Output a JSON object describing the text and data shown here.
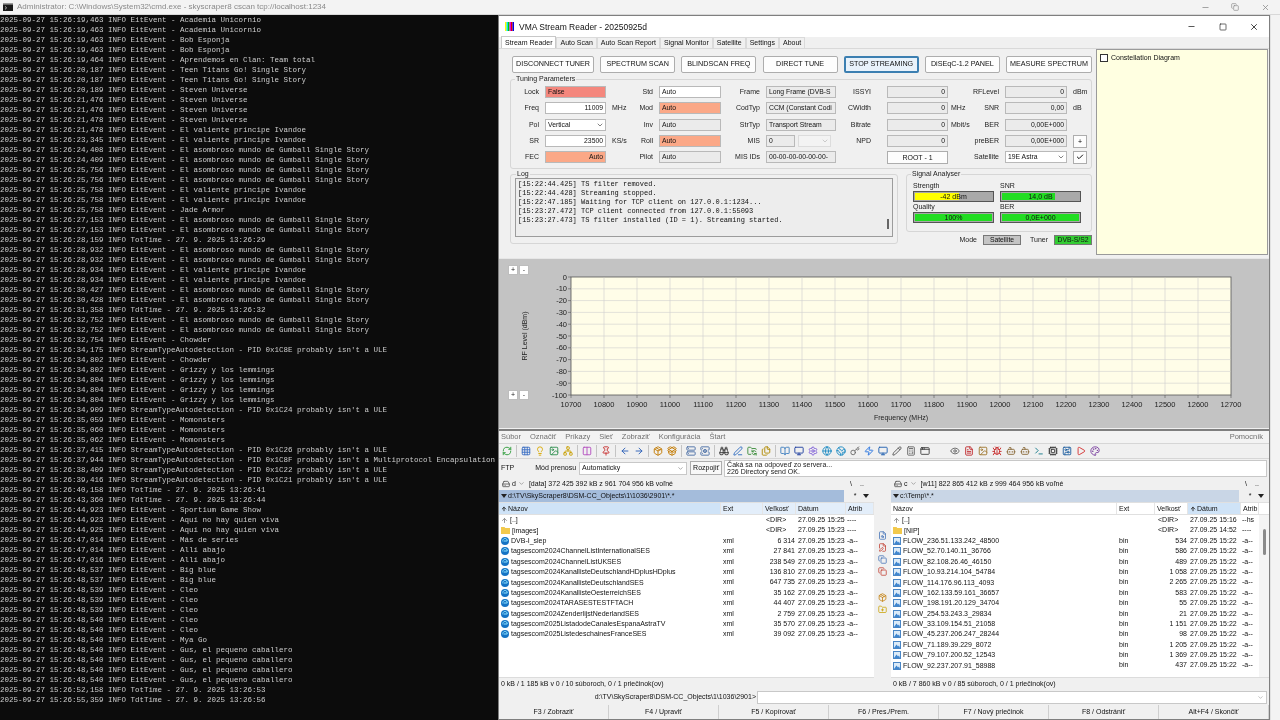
{
  "console": {
    "title": "Administrator: C:\\Windows\\System32\\cmd.exe - skyscraper8 cscan tcp://localhost:1234",
    "lines": [
      "2025-09-27 15:26:19,463 INFO EitEvent - Academia Unicornio",
      "2025-09-27 15:26:19,463 INFO EitEvent - Academia Unicornio",
      "2025-09-27 15:26:19,463 INFO EitEvent - Bob Esponja",
      "2025-09-27 15:26:19,463 INFO EitEvent - Bob Esponja",
      "2025-09-27 15:26:19,464 INFO EitEvent - Aprendemos en Clan: Team total",
      "2025-09-27 15:26:20,187 INFO EitEvent - Teen Titans Go! Single Story",
      "2025-09-27 15:26:20,187 INFO EitEvent - Teen Titans Go! Single Story",
      "2025-09-27 15:26:20,189 INFO EitEvent - Steven Universe",
      "2025-09-27 15:26:21,476 INFO EitEvent - Steven Universe",
      "2025-09-27 15:26:21,476 INFO EitEvent - Steven Universe",
      "2025-09-27 15:26:21,478 INFO EitEvent - Steven Universe",
      "2025-09-27 15:26:21,478 INFO EitEvent - El valiente príncipe Ivandoe",
      "2025-09-27 15:26:23,345 INFO EitEvent - El valiente príncipe Ivandoe",
      "2025-09-27 15:26:24,408 INFO EitEvent - El asombroso mundo de Gumball Single Story",
      "2025-09-27 15:26:24,409 INFO EitEvent - El asombroso mundo de Gumball Single Story",
      "2025-09-27 15:26:25,756 INFO EitEvent - El asombroso mundo de Gumball Single Story",
      "2025-09-27 15:26:25,756 INFO EitEvent - El asombroso mundo de Gumball Single Story",
      "2025-09-27 15:26:25,758 INFO EitEvent - El valiente príncipe Ivandoe",
      "2025-09-27 15:26:25,758 INFO EitEvent - El valiente príncipe Ivandoe",
      "2025-09-27 15:26:25,758 INFO EitEvent - Jade Armor",
      "2025-09-27 15:26:27,153 INFO EitEvent - El asombroso mundo de Gumball Single Story",
      "2025-09-27 15:26:27,153 INFO EitEvent - El asombroso mundo de Gumball Single Story",
      "2025-09-27 15:26:28,159 INFO TotTime - 27. 9. 2025 13:26:29",
      "2025-09-27 15:26:28,932 INFO EitEvent - El asombroso mundo de Gumball Single Story",
      "2025-09-27 15:26:28,932 INFO EitEvent - El asombroso mundo de Gumball Single Story",
      "2025-09-27 15:26:28,934 INFO EitEvent - El valiente príncipe Ivandoe",
      "2025-09-27 15:26:28,934 INFO EitEvent - El valiente príncipe Ivandoe",
      "2025-09-27 15:26:30,427 INFO EitEvent - El asombroso mundo de Gumball Single Story",
      "2025-09-27 15:26:30,428 INFO EitEvent - El asombroso mundo de Gumball Single Story",
      "2025-09-27 15:26:31,358 INFO TdtTime - 27. 9. 2025 13:26:32",
      "2025-09-27 15:26:32,752 INFO EitEvent - El asombroso mundo de Gumball Single Story",
      "2025-09-27 15:26:32,752 INFO EitEvent - El asombroso mundo de Gumball Single Story",
      "2025-09-27 15:26:32,754 INFO EitEvent - Chowder",
      "2025-09-27 15:26:34,175 INFO StreamTypeAutodetection - PID 0x1C8E probably isn't a ULE",
      "2025-09-27 15:26:34,802 INFO EitEvent - Chowder",
      "2025-09-27 15:26:34,802 INFO EitEvent - Grizzy y los lemmings",
      "2025-09-27 15:26:34,804 INFO EitEvent - Grizzy y los lemmings",
      "2025-09-27 15:26:34,804 INFO EitEvent - Grizzy y los lemmings",
      "2025-09-27 15:26:34,804 INFO EitEvent - Grizzy y los lemmings",
      "2025-09-27 15:26:34,909 INFO StreamTypeAutodetection - PID 0x1C24 probably isn't a ULE",
      "2025-09-27 15:26:35,059 INFO EitEvent - Momonsters",
      "2025-09-27 15:26:35,060 INFO EitEvent - Momonsters",
      "2025-09-27 15:26:35,062 INFO EitEvent - Momonsters",
      "2025-09-27 15:26:37,415 INFO StreamTypeAutodetection - PID 0x1C26 probably isn't a ULE",
      "2025-09-27 15:26:37,944 INFO StreamTypeAutodetection - PID 0x1C8F probably isn't a Multiprotocol Encapsulation",
      "2025-09-27 15:26:38,409 INFO StreamTypeAutodetection - PID 0x1C22 probably isn't a ULE",
      "2025-09-27 15:26:39,416 INFO StreamTypeAutodetection - PID 0x1C21 probably isn't a ULE",
      "2025-09-27 15:26:40,158 INFO TotTime - 27. 9. 2025 13:26:41",
      "2025-09-27 15:26:43,360 INFO TdtTime - 27. 9. 2025 13:26:44",
      "2025-09-27 15:26:44,923 INFO EitEvent - Sportium Game Show",
      "2025-09-27 15:26:44,923 INFO EitEvent - Aquí no hay quien viva",
      "2025-09-27 15:26:44,925 INFO EitEvent - Aquí no hay quien viva",
      "2025-09-27 15:26:47,014 INFO EitEvent - Más de series",
      "2025-09-27 15:26:47,014 INFO EitEvent - Allí abajo",
      "2025-09-27 15:26:47,016 INFO EitEvent - Allí abajo",
      "2025-09-27 15:26:48,537 INFO EitEvent - Big blue",
      "2025-09-27 15:26:48,537 INFO EitEvent - Big blue",
      "2025-09-27 15:26:48,539 INFO EitEvent - Cleo",
      "2025-09-27 15:26:48,539 INFO EitEvent - Cleo",
      "2025-09-27 15:26:48,539 INFO EitEvent - Cleo",
      "2025-09-27 15:26:48,540 INFO EitEvent - Cleo",
      "2025-09-27 15:26:48,540 INFO EitEvent - Cleo",
      "2025-09-27 15:26:48,540 INFO EitEvent - Mya Go",
      "2025-09-27 15:26:48,540 INFO EitEvent - Gus, el pequeno caballero",
      "2025-09-27 15:26:48,540 INFO EitEvent - Gus, el pequeno caballero",
      "2025-09-27 15:26:48,540 INFO EitEvent - Gus, el pequeno caballero",
      "2025-09-27 15:26:48,540 INFO EitEvent - Gus, el pequeno caballero",
      "2025-09-27 15:26:52,158 INFO TotTime - 27. 9. 2025 13:26:53",
      "2025-09-27 15:26:55,359 INFO TdtTime - 27. 9. 2025 13:26:56"
    ]
  },
  "stream_reader": {
    "title": "VMA Stream Reader - 20250925d",
    "tabs": [
      {
        "label": "Stream Reader",
        "selected": true
      },
      {
        "label": "Auto Scan",
        "selected": false
      },
      {
        "label": "Auto Scan Report",
        "selected": false
      },
      {
        "label": "Signal Monitor",
        "selected": false
      },
      {
        "label": "Satellite",
        "selected": false
      },
      {
        "label": "Settings",
        "selected": false
      },
      {
        "label": "About",
        "selected": false
      }
    ],
    "buttons": [
      {
        "label": "DISCONNECT TUNER",
        "focused": false
      },
      {
        "label": "SPECTRUM SCAN",
        "focused": false
      },
      {
        "label": "BLINDSCAN FREQ",
        "focused": false
      },
      {
        "label": "DIRECT TUNE",
        "focused": false
      },
      {
        "label": "STOP STREAMING",
        "focused": true
      },
      {
        "label": "DiSEqC-1.2 PANEL",
        "focused": false
      },
      {
        "label": "MEASURE SPECTRUM",
        "focused": false
      }
    ],
    "tuning": {
      "title": "Tuning Parameters",
      "rows": [
        [
          {
            "label": "Lock",
            "kind": "text",
            "value": "False",
            "color": "#f4877d"
          },
          {
            "label": "Std",
            "kind": "text",
            "value": "Auto",
            "color": "#ffffff"
          },
          {
            "label": "Frame",
            "kind": "text",
            "value": "Long Frame (DVB-S",
            "color": "#ebebeb"
          },
          {
            "label": "ISSYI",
            "kind": "number",
            "value": "0",
            "color": "#ebebeb"
          },
          {
            "label": "RFLevel",
            "kind": "number",
            "value": "0",
            "color": "#ebebeb",
            "unit": "dBm"
          }
        ],
        [
          {
            "label": "Freq",
            "kind": "number",
            "value": "11009",
            "color": "#ffffff",
            "unit": "MHz"
          },
          {
            "label": "Mod",
            "kind": "text",
            "value": "Auto",
            "color": "#fba887"
          },
          {
            "label": "CodTyp",
            "kind": "text",
            "value": "CCM (Constant Codi",
            "color": "#ebebeb"
          },
          {
            "label": "CWidth",
            "kind": "number",
            "value": "0",
            "color": "#ebebeb",
            "unit": "MHz"
          },
          {
            "label": "SNR",
            "kind": "number",
            "value": "0,00",
            "color": "#ebebeb",
            "unit": "dB"
          }
        ],
        [
          {
            "label": "Pol",
            "kind": "select",
            "value": "Vertical",
            "color": "#ffffff"
          },
          {
            "label": "Inv",
            "kind": "text",
            "value": "Auto",
            "color": "#ebebeb"
          },
          {
            "label": "StrTyp",
            "kind": "text",
            "value": "Transport Stream",
            "color": "#ebebeb"
          },
          {
            "label": "Bitrate",
            "kind": "number",
            "value": "0",
            "color": "#ebebeb",
            "unit": "Mbit/s"
          },
          {
            "label": "BER",
            "kind": "number",
            "value": "0,00E+000",
            "color": "#ebebeb"
          }
        ],
        [
          {
            "label": "SR",
            "kind": "number",
            "value": "23500",
            "color": "#ffffff",
            "unit": "KS/s"
          },
          {
            "label": "Roll",
            "kind": "text",
            "value": "Auto",
            "color": "#fba887"
          },
          {
            "label": "MIS",
            "kind": "spin_select",
            "value": "0",
            "color": "#ebebeb"
          },
          {
            "label": "NPD",
            "kind": "number",
            "value": "0",
            "color": "#ebebeb"
          },
          {
            "label": "preBER",
            "kind": "number",
            "value": "0,00E+000",
            "color": "#ebebeb",
            "action": "+"
          }
        ],
        [
          {
            "label": "FEC",
            "kind": "number",
            "value": "Auto",
            "color": "#fba887"
          },
          {
            "label": "Pilot",
            "kind": "text",
            "value": "Auto",
            "color": "#ebebeb"
          },
          {
            "label": "MIS IDs",
            "kind": "text",
            "value": "00-00-00-00-00-00-",
            "color": "#ebebeb"
          },
          {
            "kind": "button",
            "value": "ROOT - 1"
          },
          {
            "label": "Satellite",
            "kind": "select_apply",
            "value": "19E Astra",
            "color": "#ffffff"
          }
        ]
      ]
    },
    "log": {
      "title": "Log",
      "lines": [
        "[15:22:44.425] TS filter removed.",
        "[15:22:44.428] Streaming stopped.",
        "[15:22:47.185] Waiting for TCP client on 127.0.0.1:1234...",
        "[15:23:27.472] TCP client connected from 127.0.0.1:55093",
        "[15:23:27.473] TS filter installed (ID = 1). Streaming started."
      ]
    },
    "signal": {
      "title": "Signal Analyser",
      "meters": [
        {
          "label": "Strength",
          "reading": "-42 dBm",
          "level": 0.57,
          "color": "#ffff00"
        },
        {
          "label": "SNR",
          "reading": "14,0 dB",
          "level": 0.69,
          "color": "#22dd22"
        },
        {
          "label": "Quality",
          "reading": "100%",
          "level": 1,
          "color": "#22dd22"
        },
        {
          "label": "BER",
          "reading": "0,0E+000",
          "level": 1,
          "color": "#22dd22"
        }
      ],
      "indicators": [
        {
          "label": "Mode",
          "value": "Satellite",
          "color": "#c4c4c4"
        },
        {
          "label": "Tuner",
          "value": "DVB-S/S2",
          "color": "#33cc33"
        }
      ]
    },
    "constellation": {
      "label": "Constellation Diagram",
      "checked": false
    },
    "spectrum": {
      "zoom_buttons_top": [
        "+",
        "-"
      ],
      "zoom_buttons_bottom": [
        "+",
        "-"
      ],
      "chart_data": {
        "type": "line",
        "xlabel": "Frequency (MHz)",
        "ylabel": "RF Level (dBm)",
        "xlim": [
          10700,
          12700
        ],
        "ylim": [
          -100,
          0
        ],
        "xticks": [
          10700,
          10800,
          10900,
          11000,
          11100,
          11200,
          11300,
          11400,
          11500,
          11600,
          11700,
          11800,
          11900,
          12000,
          12100,
          12200,
          12300,
          12400,
          12500,
          12600,
          12700
        ],
        "yticks": [
          0,
          -10,
          -20,
          -30,
          -40,
          -50,
          -60,
          -70,
          -80,
          -90,
          -100
        ],
        "grid": true
      }
    }
  },
  "file_manager": {
    "menu": [
      "Súbor",
      "Označiť",
      "Príkazy",
      "Sieť",
      "Zobraziť",
      "Konfigurácia",
      "Štart"
    ],
    "help_menu": "Pomocník",
    "ftp": {
      "label": "FTP",
      "mode_label": "Mód prenosu",
      "mode": "Automaticky",
      "disconnect": "Rozpojiť",
      "messages": [
        "Čaká sa na odpoveď zo servera...",
        "226 Directory send OK."
      ]
    },
    "panels": [
      {
        "active": true,
        "drive": "d",
        "drive_info": "[data] 372 425 392 kB z 961 704 956 kB voľné",
        "root_button": "\\",
        "parent_button": "..",
        "path": "d:\\TV\\SkyScraper8\\DSM-CC_Objects\\1\\1036\\2901\\*.*",
        "history_button": "*",
        "columns": [
          {
            "label": "Názov",
            "sorted": true
          },
          {
            "label": "Ext",
            "sorted": false
          },
          {
            "label": "Veľkosť",
            "sorted": false
          },
          {
            "label": "Dátum",
            "sorted": false
          },
          {
            "label": "Atrib",
            "sorted": false
          }
        ],
        "rows": [
          {
            "kind": "up",
            "name": "[..]",
            "size": "<DIR>",
            "date": "27.09.25 15:25",
            "attr": "----"
          },
          {
            "kind": "folder",
            "name": "[images]",
            "size": "<DIR>",
            "date": "27.09.25 15:23",
            "attr": "----"
          },
          {
            "kind": "document",
            "name": "DVB-I_slep",
            "ext": "xml",
            "size": "6 314",
            "date": "27.09.25 15:23",
            "attr": "-a--"
          },
          {
            "kind": "document",
            "name": "tagsescom2024ChannelListInternationalSES",
            "ext": "xml",
            "size": "27 841",
            "date": "27.09.25 15:23",
            "attr": "-a--"
          },
          {
            "kind": "document",
            "name": "tagsescom2024ChannelListUKSES",
            "ext": "xml",
            "size": "238 549",
            "date": "27.09.25 15:23",
            "attr": "-a--"
          },
          {
            "kind": "document",
            "name": "tagsescom2024KanallisteDeutschlandHDplusHDplus",
            "ext": "xml",
            "size": "136 810",
            "date": "27.09.25 15:23",
            "attr": "-a--"
          },
          {
            "kind": "document",
            "name": "tagsescom2024KanallisteDeutschlandSES",
            "ext": "xml",
            "size": "647 735",
            "date": "27.09.25 15:23",
            "attr": "-a--"
          },
          {
            "kind": "document",
            "name": "tagsescom2024KanallisteOesterreichSES",
            "ext": "xml",
            "size": "35 162",
            "date": "27.09.25 15:23",
            "attr": "-a--"
          },
          {
            "kind": "document",
            "name": "tagsescom2024TARASESTESTFTACH",
            "ext": "xml",
            "size": "44 407",
            "date": "27.09.25 15:23",
            "attr": "-a--"
          },
          {
            "kind": "document",
            "name": "tagsescom2024ZenderlijstNederlandSES",
            "ext": "xml",
            "size": "2 759",
            "date": "27.09.25 15:23",
            "attr": "-a--"
          },
          {
            "kind": "document",
            "name": "tagsescom2025ListadodeCanalesEspanaAstraTV",
            "ext": "xml",
            "size": "35 570",
            "date": "27.09.25 15:23",
            "attr": "-a--"
          },
          {
            "kind": "document",
            "name": "tagsescom2025ListedeschainesFranceSES",
            "ext": "xml",
            "size": "39 092",
            "date": "27.09.25 15:23",
            "attr": "-a--"
          }
        ],
        "status": "0 kB / 1 185 kB v 0 / 10 súboroch, 0 / 1 priečinok(ov)"
      },
      {
        "active": false,
        "drive": "c",
        "drive_info": "[w11] 822 865 412 kB z 999 464 956 kB voľné",
        "root_button": "\\",
        "parent_button": "..",
        "path": "c:\\Temp\\*.*",
        "history_button": "*",
        "columns": [
          {
            "label": "Názov",
            "sorted": false
          },
          {
            "label": "Ext",
            "sorted": false
          },
          {
            "label": "Veľkosť",
            "sorted": false
          },
          {
            "label": "Dátum",
            "sorted": true
          },
          {
            "label": "Atrib",
            "sorted": false
          }
        ],
        "rows": [
          {
            "kind": "up",
            "name": "[..]",
            "size": "<DIR>",
            "date": "27.09.25 15:16",
            "attr": "--hs"
          },
          {
            "kind": "folder",
            "name": "[NIP]",
            "size": "<DIR>",
            "date": "27.09.25 14:52",
            "attr": "----"
          },
          {
            "kind": "binary",
            "name": "FLOW_236.51.133.242_48500",
            "ext": "bin",
            "size": "534",
            "date": "27.09.25 15:22",
            "attr": "-a--"
          },
          {
            "kind": "binary",
            "name": "FLOW_52.70.140.11_36766",
            "ext": "bin",
            "size": "586",
            "date": "27.09.25 15:22",
            "attr": "-a--"
          },
          {
            "kind": "binary",
            "name": "FLOW_82.108.26.46_46150",
            "ext": "bin",
            "size": "489",
            "date": "27.09.25 15:22",
            "attr": "-a--"
          },
          {
            "kind": "binary",
            "name": "FLOW_10.93.214.104_54784",
            "ext": "bin",
            "size": "1 058",
            "date": "27.09.25 15:22",
            "attr": "-a--"
          },
          {
            "kind": "binary",
            "name": "FLOW_114.176.96.113_4093",
            "ext": "bin",
            "size": "2 265",
            "date": "27.09.25 15:22",
            "attr": "-a--"
          },
          {
            "kind": "binary",
            "name": "FLOW_162.133.59.161_36657",
            "ext": "bin",
            "size": "583",
            "date": "27.09.25 15:22",
            "attr": "-a--"
          },
          {
            "kind": "binary",
            "name": "FLOW_198.191.20.129_34704",
            "ext": "bin",
            "size": "55",
            "date": "27.09.25 15:22",
            "attr": "-a--"
          },
          {
            "kind": "binary",
            "name": "FLOW_254.53.243.3_29834",
            "ext": "bin",
            "size": "21",
            "date": "27.09.25 15:22",
            "attr": "-a--"
          },
          {
            "kind": "binary",
            "name": "FLOW_33.109.154.51_21058",
            "ext": "bin",
            "size": "1 151",
            "date": "27.09.25 15:22",
            "attr": "-a--"
          },
          {
            "kind": "binary",
            "name": "FLOW_45.237.206.247_28244",
            "ext": "bin",
            "size": "98",
            "date": "27.09.25 15:22",
            "attr": "-a--"
          },
          {
            "kind": "binary",
            "name": "FLOW_71.189.39.229_8072",
            "ext": "bin",
            "size": "1 205",
            "date": "27.09.25 15:22",
            "attr": "-a--"
          },
          {
            "kind": "binary",
            "name": "FLOW_79.107.200.52_12543",
            "ext": "bin",
            "size": "1 369",
            "date": "27.09.25 15:22",
            "attr": "-a--"
          },
          {
            "kind": "binary",
            "name": "FLOW_92.237.207.91_58988",
            "ext": "bin",
            "size": "437",
            "date": "27.09.25 15:22",
            "attr": "-a--"
          }
        ],
        "status": "0 kB / 7 860 kB v 0 / 85 súboroch, 0 / 1 priečinok(ov)"
      }
    ],
    "command_path": "d:\\TV\\SkyScraper8\\DSM-CC_Objects\\1\\1036\\2901>",
    "function_keys": [
      "F3 / Zobraziť",
      "F4 / Upraviť",
      "F5 / Kopírovať",
      "F6 / Pres./Prem.",
      "F7 / Nový priečinok",
      "F8 / Odstrániť",
      "Alt+F4 / Skončiť"
    ]
  }
}
